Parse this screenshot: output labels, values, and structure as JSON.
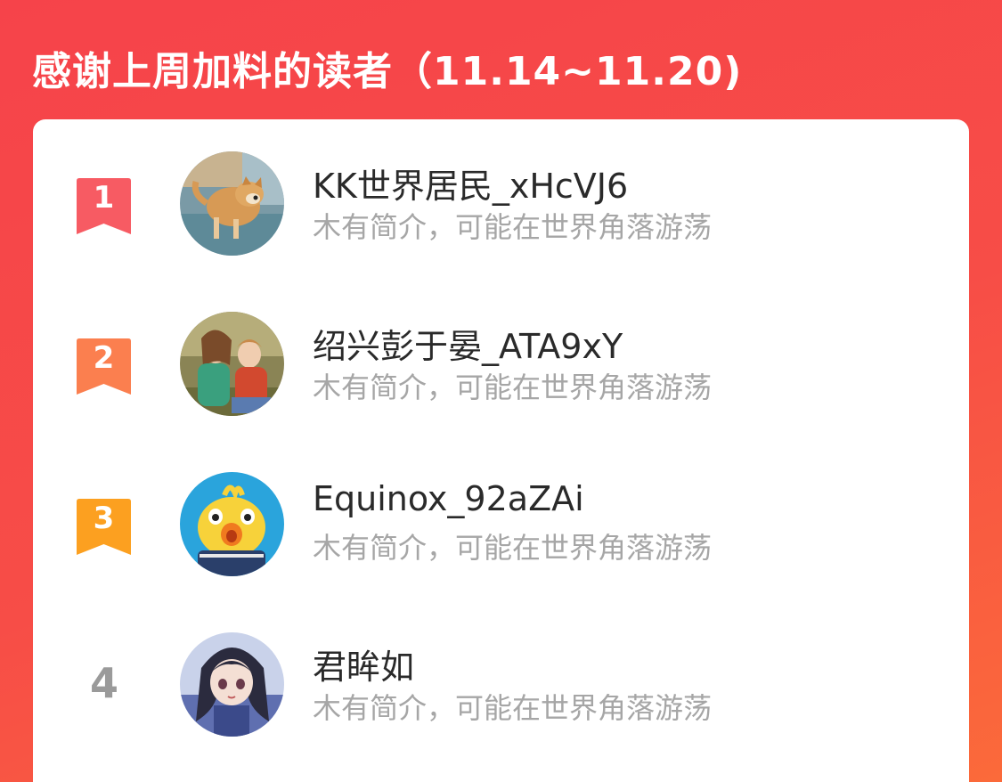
{
  "header": {
    "title": "感谢上周加料的读者（11.14~11.20)"
  },
  "colors": {
    "background": "#f6434a",
    "rank1": "#f75b63",
    "rank2": "#fb7f4f",
    "rank3": "#fca020",
    "rank_plain": "#9a9a9a",
    "bio": "#a6a6a6"
  },
  "readers": [
    {
      "rank": "1",
      "name": "KK世界居民_xHcVJ6",
      "bio": "木有简介，可能在世界角落游荡",
      "avatar": "dog-avatar"
    },
    {
      "rank": "2",
      "name": "绍兴彭于晏_ATA9xY",
      "bio": "木有简介，可能在世界角落游荡",
      "avatar": "children-avatar"
    },
    {
      "rank": "3",
      "name": "Equinox_92aZAi",
      "bio": "木有简介，可能在世界角落游荡",
      "avatar": "chick-avatar"
    },
    {
      "rank": "4",
      "name": "君眸如",
      "bio": "木有简介，可能在世界角落游荡",
      "avatar": "anime-girl-avatar"
    }
  ]
}
